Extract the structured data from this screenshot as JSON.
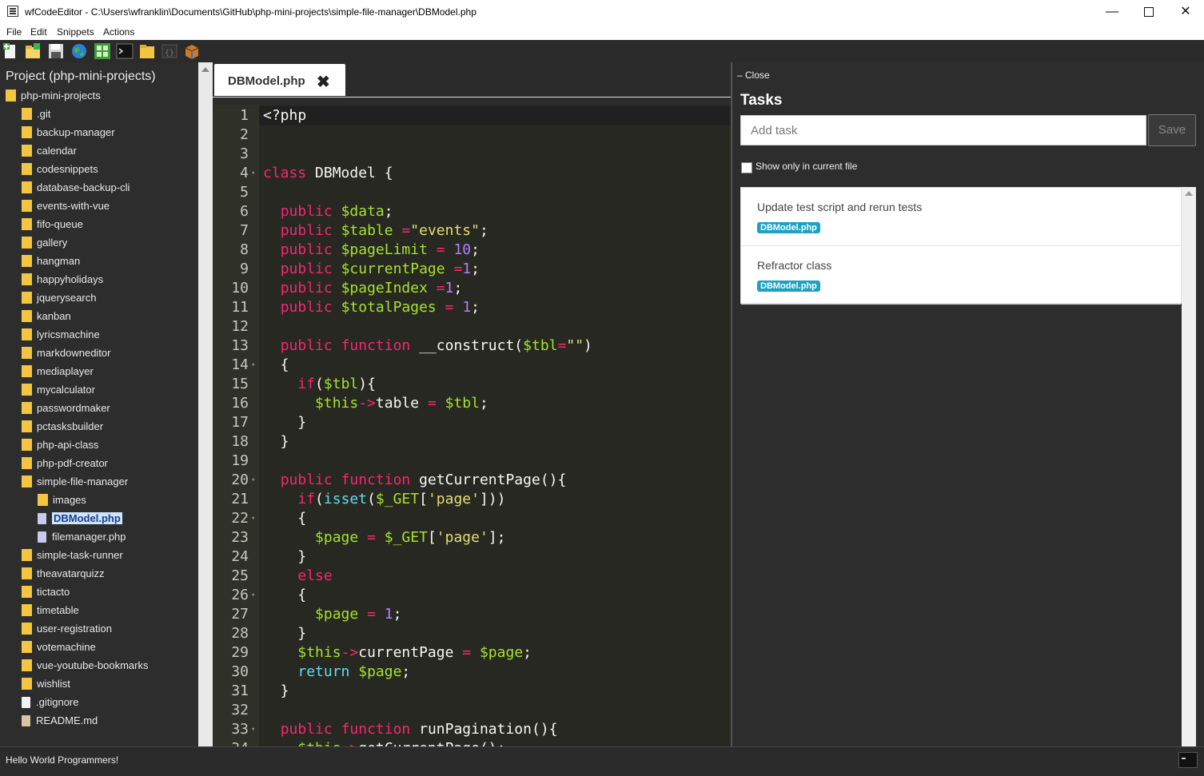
{
  "window": {
    "title": "wfCodeEditor - C:\\Users\\wfranklin\\Documents\\GitHub\\php-mini-projects\\simple-file-manager\\DBModel.php",
    "minimize": "—",
    "close": "✕"
  },
  "menu": [
    "File",
    "Edit",
    "Snippets",
    "Actions"
  ],
  "toolbar": {
    "icons": [
      "new-file-icon",
      "new-folder-icon",
      "save-icon",
      "globe-icon",
      "grid-icon",
      "terminal-icon",
      "folder-icon",
      "code-icon",
      "box-icon"
    ]
  },
  "sidebar": {
    "title": "Project (php-mini-projects)",
    "tree": [
      {
        "label": "php-mini-projects",
        "type": "folder",
        "depth": 0
      },
      {
        "label": ".git",
        "type": "folder",
        "depth": 1
      },
      {
        "label": "backup-manager",
        "type": "folder",
        "depth": 1
      },
      {
        "label": "calendar",
        "type": "folder",
        "depth": 1
      },
      {
        "label": "codesnippets",
        "type": "folder",
        "depth": 1
      },
      {
        "label": "database-backup-cli",
        "type": "folder",
        "depth": 1
      },
      {
        "label": "events-with-vue",
        "type": "folder",
        "depth": 1
      },
      {
        "label": "fifo-queue",
        "type": "folder",
        "depth": 1
      },
      {
        "label": "gallery",
        "type": "folder",
        "depth": 1
      },
      {
        "label": "hangman",
        "type": "folder",
        "depth": 1
      },
      {
        "label": "happyholidays",
        "type": "folder",
        "depth": 1
      },
      {
        "label": "jquerysearch",
        "type": "folder",
        "depth": 1
      },
      {
        "label": "kanban",
        "type": "folder",
        "depth": 1
      },
      {
        "label": "lyricsmachine",
        "type": "folder",
        "depth": 1
      },
      {
        "label": "markdowneditor",
        "type": "folder",
        "depth": 1
      },
      {
        "label": "mediaplayer",
        "type": "folder",
        "depth": 1
      },
      {
        "label": "mycalculator",
        "type": "folder",
        "depth": 1
      },
      {
        "label": "passwordmaker",
        "type": "folder",
        "depth": 1
      },
      {
        "label": "pctasksbuilder",
        "type": "folder",
        "depth": 1
      },
      {
        "label": "php-api-class",
        "type": "folder",
        "depth": 1
      },
      {
        "label": "php-pdf-creator",
        "type": "folder",
        "depth": 1
      },
      {
        "label": "simple-file-manager",
        "type": "folder",
        "depth": 1
      },
      {
        "label": "images",
        "type": "folder",
        "depth": 2
      },
      {
        "label": "DBModel.php",
        "type": "php",
        "depth": 2,
        "selected": true
      },
      {
        "label": "filemanager.php",
        "type": "php",
        "depth": 2
      },
      {
        "label": "simple-task-runner",
        "type": "folder",
        "depth": 1
      },
      {
        "label": "theavatarquizz",
        "type": "folder",
        "depth": 1
      },
      {
        "label": "tictacto",
        "type": "folder",
        "depth": 1
      },
      {
        "label": "timetable",
        "type": "folder",
        "depth": 1
      },
      {
        "label": "user-registration",
        "type": "folder",
        "depth": 1
      },
      {
        "label": "votemachine",
        "type": "folder",
        "depth": 1
      },
      {
        "label": "vue-youtube-bookmarks",
        "type": "folder",
        "depth": 1
      },
      {
        "label": "wishlist",
        "type": "folder",
        "depth": 1
      },
      {
        "label": ".gitignore",
        "type": "file",
        "depth": 1
      },
      {
        "label": "README.md",
        "type": "md",
        "depth": 1
      }
    ]
  },
  "editor": {
    "tab_label": "DBModel.php",
    "tab_close": "✖",
    "lines": [
      "<?php",
      "",
      "",
      "class DBModel {",
      "",
      "  public $data;",
      "  public $table =\"events\";",
      "  public $pageLimit = 10;",
      "  public $currentPage =1;",
      "  public $pageIndex =1;",
      "  public $totalPages = 1;",
      "",
      "  public function __construct($tbl=\"\")",
      "  {",
      "    if($tbl){",
      "      $this->table = $tbl;",
      "    }",
      "  }",
      "",
      "  public function getCurrentPage(){",
      "    if(isset($_GET['page']))",
      "    {",
      "      $page = $_GET['page'];",
      "    }",
      "    else",
      "    {",
      "      $page = 1;",
      "    }",
      "    $this->currentPage = $page;",
      "    return $page;",
      "  }",
      "",
      "  public function runPagination(){",
      "    $this->getCurrentPage();"
    ],
    "fold_lines": [
      4,
      14,
      20,
      22,
      26,
      33
    ]
  },
  "tasks": {
    "close_label": "– Close",
    "title": "Tasks",
    "input_placeholder": "Add task",
    "save_label": "Save",
    "filter_label": "Show only in current file",
    "items": [
      {
        "text": "Update test script and rerun tests",
        "badge": "DBModel.php"
      },
      {
        "text": "Refractor class",
        "badge": "DBModel.php"
      }
    ]
  },
  "status": {
    "text": "Hello World Programmers!"
  }
}
